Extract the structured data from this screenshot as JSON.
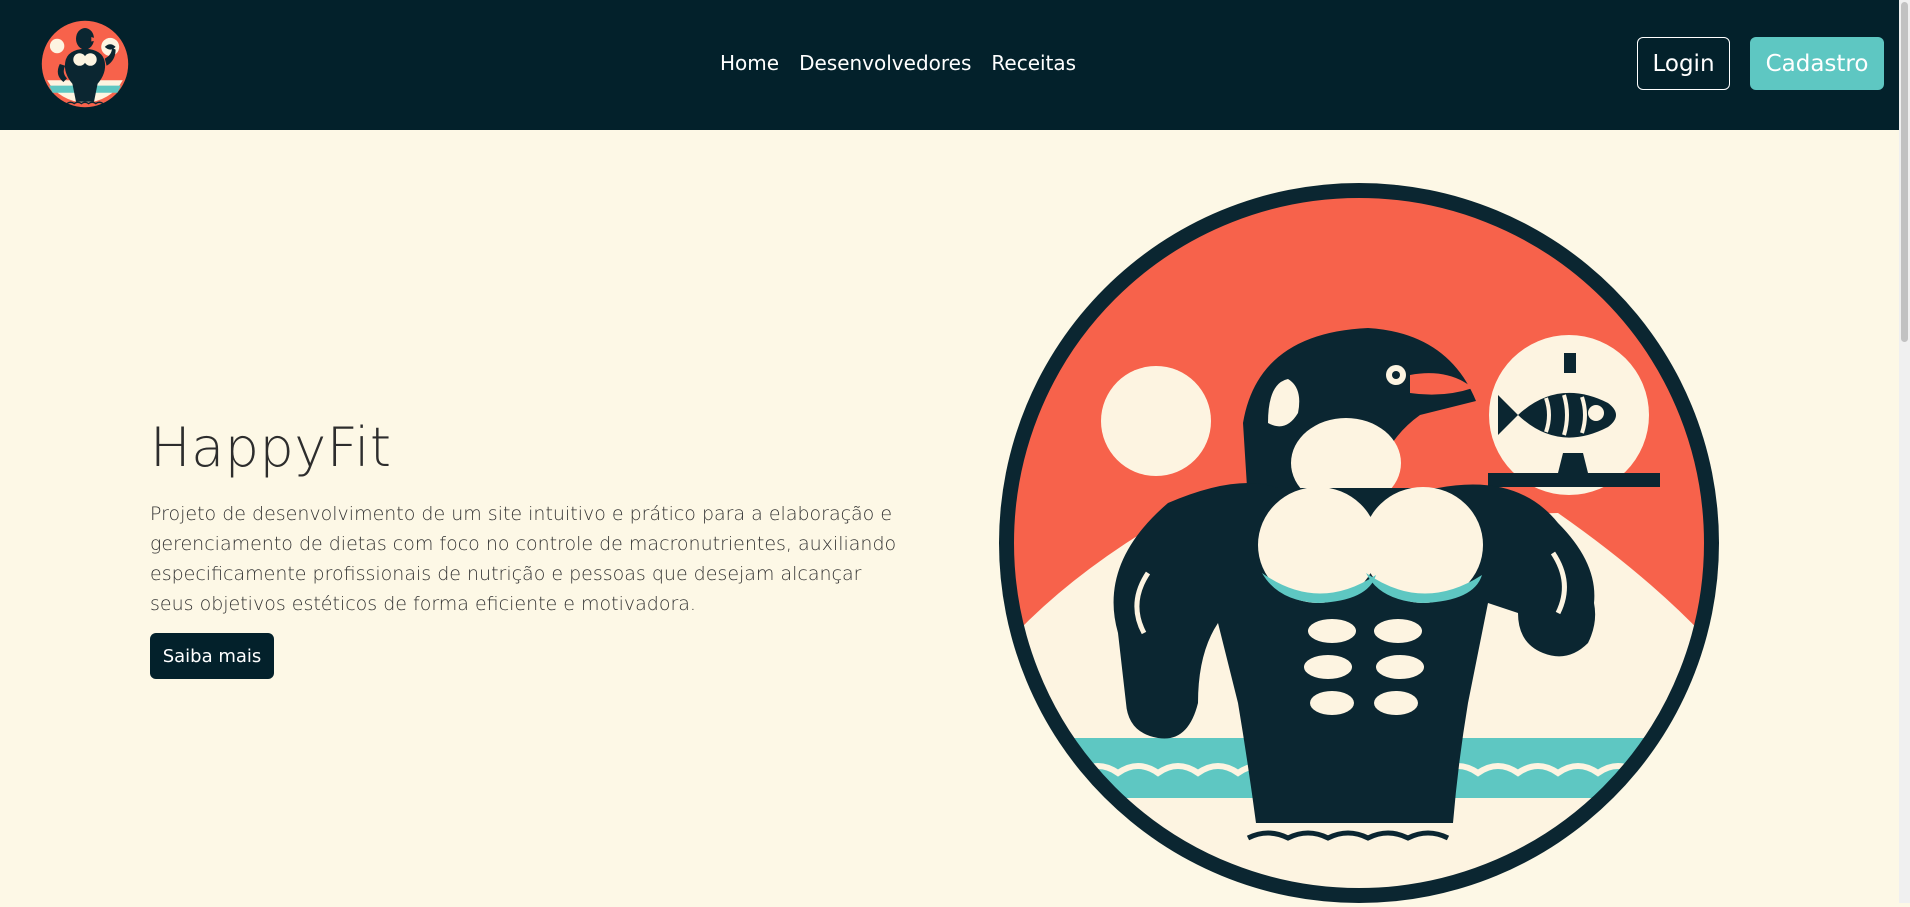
{
  "navbar": {
    "links": [
      {
        "label": "Home"
      },
      {
        "label": "Desenvolvedores"
      },
      {
        "label": "Receitas"
      }
    ],
    "login_label": "Login",
    "signup_label": "Cadastro",
    "logo_icon": "penguin-logo-icon"
  },
  "hero": {
    "title": "HappyFit",
    "description": "Projeto de desenvolvimento de um site intuitivo e prático para a elaboração e gerenciamento de dietas com foco no controle de macronutrientes, auxiliando especificamente profissionais de nutrição e pessoas que desejam alcançar seus objetivos estéticos de forma eficiente e motivadora.",
    "cta_label": "Saiba mais",
    "illustration_icon": "muscular-penguin-illustration"
  },
  "colors": {
    "navbar_bg": "#03212b",
    "page_bg": "#fdf8e6",
    "accent": "#5ec7c2",
    "coral": "#f7624b",
    "dark": "#0b2631",
    "cream": "#fdf4e1"
  }
}
